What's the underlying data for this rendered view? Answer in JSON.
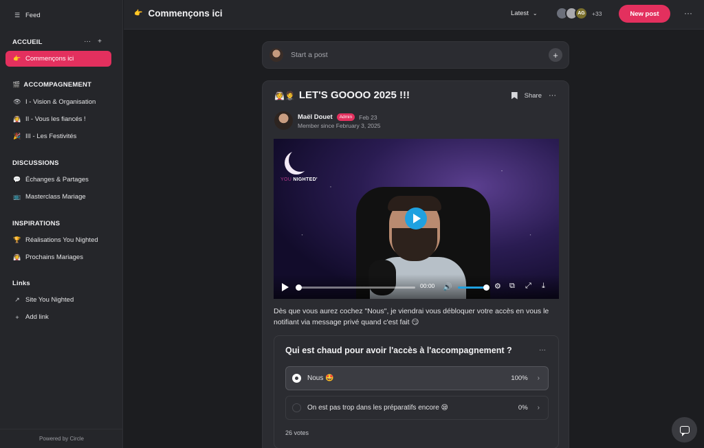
{
  "sidebar": {
    "feed_label": "Feed",
    "sections": [
      {
        "title": "ACCUEIL",
        "items": [
          {
            "label": "Commençons ici",
            "icon": "👉",
            "active": true
          }
        ]
      },
      {
        "title": "ACCOMPAGNEMENT",
        "icon": "🎬",
        "items": [
          {
            "label": "I - Vision & Organisation",
            "icon": "👁"
          },
          {
            "label": "II - Vous les fiancés !",
            "icon": "👰"
          },
          {
            "label": "III - Les Festivités",
            "icon": "🎉"
          }
        ]
      },
      {
        "title": "DISCUSSIONS",
        "items": [
          {
            "label": "Échanges & Partages",
            "icon": "💬"
          },
          {
            "label": "Masterclass Mariage",
            "icon": "📺"
          }
        ]
      },
      {
        "title": "INSPIRATIONS",
        "items": [
          {
            "label": "Réalisations You Nighted",
            "icon": "🏆"
          },
          {
            "label": "Prochains Mariages",
            "icon": "👰"
          }
        ]
      },
      {
        "title": "Links",
        "items": [
          {
            "label": "Site You Nighted",
            "icon": "↗"
          },
          {
            "label": "Add link",
            "icon": "+"
          }
        ]
      }
    ],
    "section_actions": {
      "more": "···",
      "add": "+"
    },
    "powered_by": "Powered by Circle"
  },
  "topbar": {
    "title": "Commençons ici",
    "title_icon": "👉",
    "sort_label": "Latest",
    "avatar_initials": "AG",
    "members_more": "+33",
    "new_post_label": "New post",
    "more": "···"
  },
  "composer": {
    "placeholder": "Start a post",
    "plus": "+"
  },
  "post": {
    "title_emojis": "👰🤵",
    "title": "LET'S GOOOO 2025 !!!",
    "share_label": "Share",
    "more": "···",
    "author": "Maël Douet",
    "author_badge": "Admin",
    "date": "Feb 23",
    "member_since": "Member since February 3, 2025",
    "video": {
      "logo_text_a": "YOU",
      "logo_text_b": "NIGHTED'",
      "time": "00:00",
      "progress": 0,
      "volume": 1
    },
    "body": "Dès que vous aurez cochez \"Nous\", je viendrai vous débloquer votre accès en vous le notifiant via message privé quand c'est fait 😏"
  },
  "poll": {
    "question": "Qui est chaud pour avoir l'accès à l'accompagnement ?",
    "more": "···",
    "options": [
      {
        "label": "Nous 🤩",
        "percent": "100%",
        "selected": true
      },
      {
        "label": "On est pas trop dans les préparatifs encore 😪",
        "percent": "0%",
        "selected": false
      }
    ],
    "votes": "26 votes"
  },
  "colors": {
    "accent": "#e3305e",
    "player_blue": "#1fa1e0",
    "bg": "#1c1d20",
    "panel": "#2b2c31"
  }
}
